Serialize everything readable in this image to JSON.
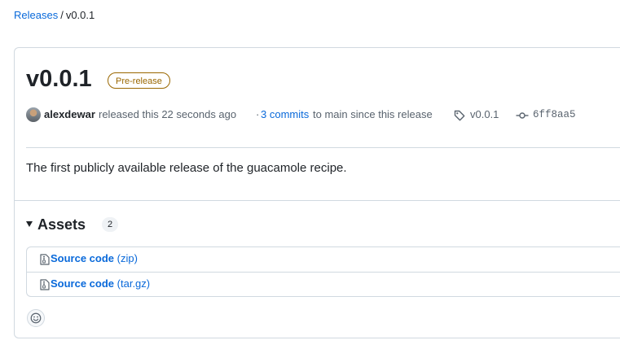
{
  "breadcrumb": {
    "releases_label": "Releases",
    "separator": "/",
    "current": "v0.0.1"
  },
  "release": {
    "title": "v0.0.1",
    "badge": "Pre-release",
    "author": "alexdewar",
    "released_text": "released this 22 seconds ago",
    "bullet": "·",
    "commits_link": "3 commits",
    "commits_suffix": "to main since this release",
    "tag": "v0.0.1",
    "commit_sha": "6ff8aa5",
    "description": "The first publicly available release of the guacamole recipe."
  },
  "assets": {
    "title": "Assets",
    "count": "2",
    "items": [
      {
        "name": "Source code",
        "ext": "(zip)"
      },
      {
        "name": "Source code",
        "ext": "(tar.gz)"
      }
    ]
  },
  "icons": {
    "tag": "tag-icon",
    "commit": "git-commit-icon",
    "file": "file-zip-icon",
    "reaction": "smiley-icon"
  },
  "colors": {
    "link": "#0969da",
    "prerelease": "#9a6700",
    "border": "#d1d9e0",
    "text": "#1f2328",
    "muted": "#59636e"
  }
}
